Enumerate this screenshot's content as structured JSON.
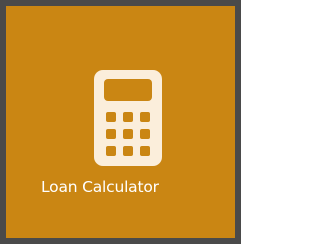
{
  "tile": {
    "label": "Loan Calculator",
    "icon": "calculator-icon",
    "background_color": "#ca8613",
    "border_color": "#4a4a4a",
    "icon_color": "#fbeedb",
    "label_color": "#ffffff"
  }
}
